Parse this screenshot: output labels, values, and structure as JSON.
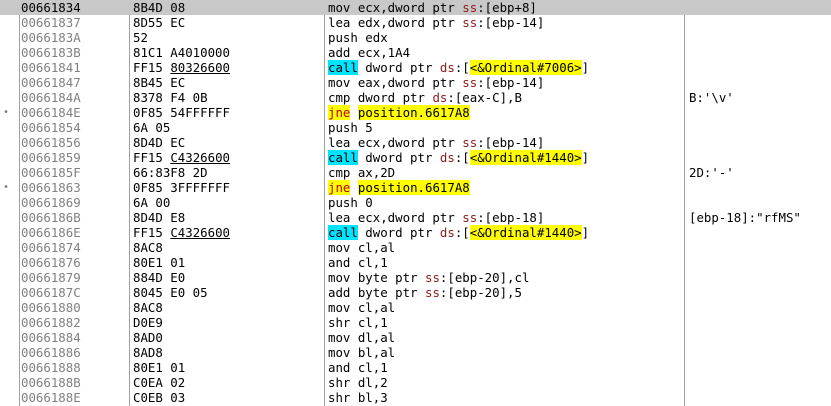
{
  "rows": [
    {
      "addr": "00661834",
      "bytes": "8B4D 08",
      "instr": "mov ecx,dword ptr ss:[ebp+8]",
      "comment": "",
      "selected": true
    },
    {
      "addr": "00661837",
      "bytes": "8D55 EC",
      "instr": "lea edx,dword ptr ss:[ebp-14]",
      "comment": ""
    },
    {
      "addr": "0066183A",
      "bytes": "52",
      "instr": "push edx",
      "comment": ""
    },
    {
      "addr": "0066183B",
      "bytes": "81C1 A4010000",
      "instr": "add ecx,1A4",
      "comment": ""
    },
    {
      "addr": "00661841",
      "bytes": "FF15 80326600",
      "instr": "call dword ptr ds:[<&Ordinal#7006>]",
      "comment": ""
    },
    {
      "addr": "00661847",
      "bytes": "8B45 EC",
      "instr": "mov eax,dword ptr ss:[ebp-14]",
      "comment": ""
    },
    {
      "addr": "0066184A",
      "bytes": "8378 F4 0B",
      "instr": "cmp dword ptr ds:[eax-C],B",
      "comment": "B:'\\v'"
    },
    {
      "addr": "0066184E",
      "bytes": "0F85 54FFFFFF",
      "instr": "jne position.6617A8",
      "comment": "",
      "jmp": true
    },
    {
      "addr": "00661854",
      "bytes": "6A 05",
      "instr": "push 5",
      "comment": ""
    },
    {
      "addr": "00661856",
      "bytes": "8D4D EC",
      "instr": "lea ecx,dword ptr ss:[ebp-14]",
      "comment": ""
    },
    {
      "addr": "00661859",
      "bytes": "FF15 C4326600",
      "instr": "call dword ptr ds:[<&Ordinal#1440>]",
      "comment": ""
    },
    {
      "addr": "0066185F",
      "bytes": "66:83F8 2D",
      "instr": "cmp ax,2D",
      "comment": "2D:'-'"
    },
    {
      "addr": "00661863",
      "bytes": "0F85 3FFFFFFF",
      "instr": "jne position.6617A8",
      "comment": "",
      "jmp": true
    },
    {
      "addr": "00661869",
      "bytes": "6A 00",
      "instr": "push 0",
      "comment": ""
    },
    {
      "addr": "0066186B",
      "bytes": "8D4D E8",
      "instr": "lea ecx,dword ptr ss:[ebp-18]",
      "comment": "[ebp-18]:\"rfMS\""
    },
    {
      "addr": "0066186E",
      "bytes": "FF15 C4326600",
      "instr": "call dword ptr ds:[<&Ordinal#1440>]",
      "comment": ""
    },
    {
      "addr": "00661874",
      "bytes": "8AC8",
      "instr": "mov cl,al",
      "comment": ""
    },
    {
      "addr": "00661876",
      "bytes": "80E1 01",
      "instr": "and cl,1",
      "comment": ""
    },
    {
      "addr": "00661879",
      "bytes": "884D E0",
      "instr": "mov byte ptr ss:[ebp-20],cl",
      "comment": ""
    },
    {
      "addr": "0066187C",
      "bytes": "8045 E0 05",
      "instr": "add byte ptr ss:[ebp-20],5",
      "comment": ""
    },
    {
      "addr": "00661880",
      "bytes": "8AC8",
      "instr": "mov cl,al",
      "comment": ""
    },
    {
      "addr": "00661882",
      "bytes": "D0E9",
      "instr": "shr cl,1",
      "comment": ""
    },
    {
      "addr": "00661884",
      "bytes": "8AD0",
      "instr": "mov dl,al",
      "comment": ""
    },
    {
      "addr": "00661886",
      "bytes": "8AD8",
      "instr": "mov bl,al",
      "comment": ""
    },
    {
      "addr": "00661888",
      "bytes": "80E1 01",
      "instr": "and cl,1",
      "comment": ""
    },
    {
      "addr": "0066188B",
      "bytes": "C0EA 02",
      "instr": "shr dl,2",
      "comment": ""
    },
    {
      "addr": "0066188E",
      "bytes": "C0EB 03",
      "instr": "shr bl,3",
      "comment": ""
    }
  ],
  "colors": {
    "selected_row": "#c8c8c8",
    "call_highlight": "#00e5ff",
    "jump_highlight": "#ffff00",
    "jump_text": "#c00000",
    "address": "#808080"
  }
}
